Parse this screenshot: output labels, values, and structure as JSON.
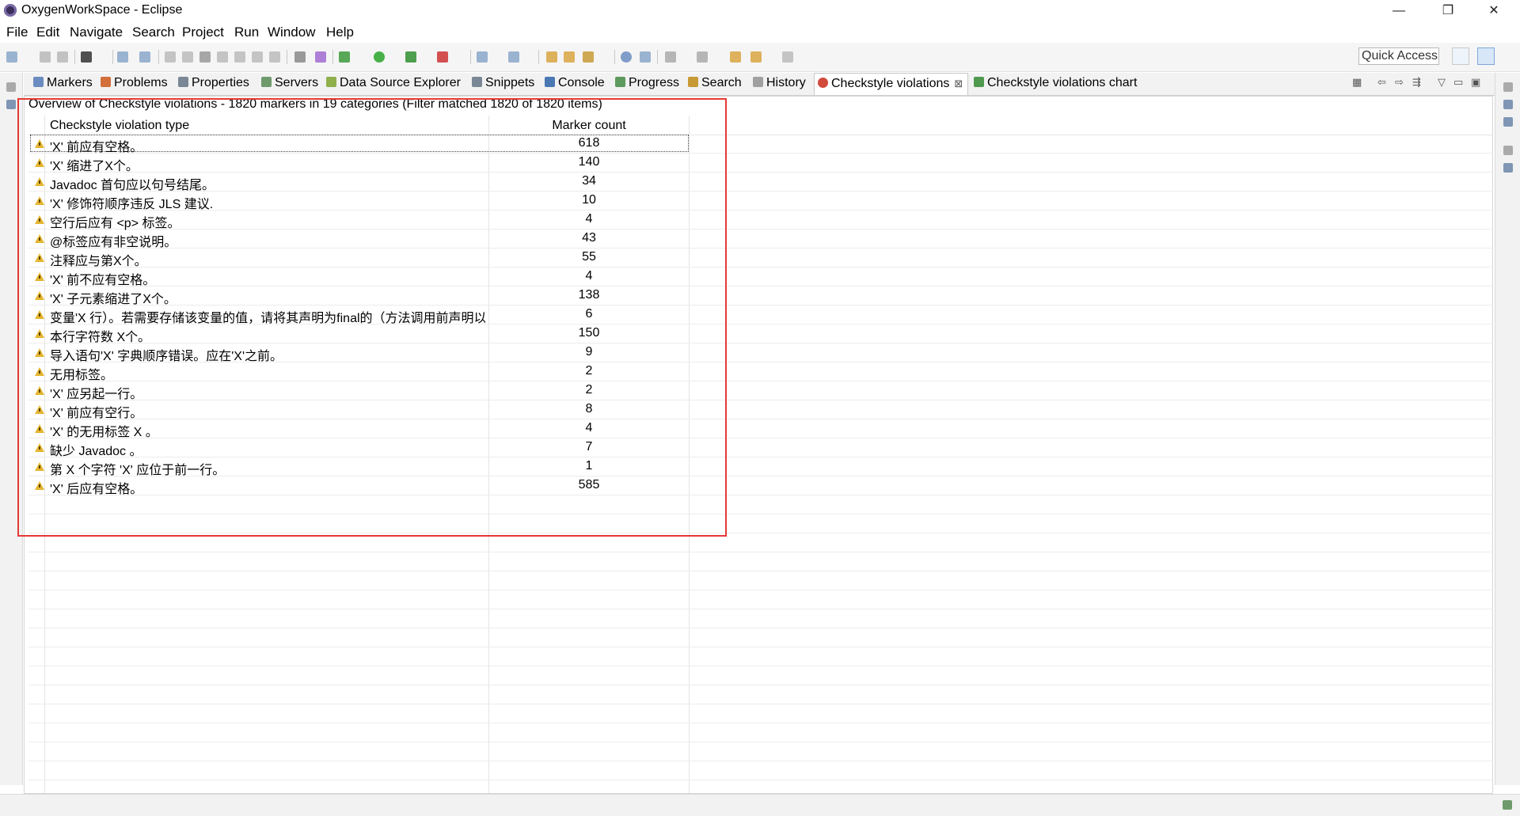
{
  "window": {
    "title": "OxygenWorkSpace - Eclipse",
    "minimize": "—",
    "restore": "❐",
    "close": "✕"
  },
  "menu": [
    "File",
    "Edit",
    "Navigate",
    "Search",
    "Project",
    "Run",
    "Window",
    "Help"
  ],
  "toolbar": {
    "quick_access": "Quick Access"
  },
  "tabs": [
    {
      "label": "Markers",
      "icon": "markers-icon",
      "color": "#6b8cc1"
    },
    {
      "label": "Problems",
      "icon": "problems-icon",
      "color": "#d36f3b"
    },
    {
      "label": "Properties",
      "icon": "properties-icon",
      "color": "#7a8794"
    },
    {
      "label": "Servers",
      "icon": "servers-icon",
      "color": "#6f9b6c"
    },
    {
      "label": "Data Source Explorer",
      "icon": "data-source-icon",
      "color": "#8fb04a"
    },
    {
      "label": "Snippets",
      "icon": "snippets-icon",
      "color": "#7a8794"
    },
    {
      "label": "Console",
      "icon": "console-icon",
      "color": "#4a78b3"
    },
    {
      "label": "Progress",
      "icon": "progress-icon",
      "color": "#5d9a5d"
    },
    {
      "label": "Search",
      "icon": "search-icon",
      "color": "#c89a36"
    },
    {
      "label": "History",
      "icon": "history-icon",
      "color": "#a0a0a0"
    },
    {
      "label": "Checkstyle violations",
      "icon": "checkstyle-icon",
      "color": "#d24a3c",
      "active": true
    },
    {
      "label": "Checkstyle violations chart",
      "icon": "checkstyle-chart-icon",
      "color": "#4f9a4f"
    }
  ],
  "view": {
    "summary": "Overview of Checkstyle violations - 1820 markers in 19 categories (Filter matched 1820 of 1820 items)",
    "columns": {
      "type": "Checkstyle violation type",
      "count": "Marker count"
    },
    "rows": [
      {
        "type": "'X' 前应有空格。",
        "count": "618"
      },
      {
        "type": "'X' 缩进了X个。",
        "count": "140"
      },
      {
        "type": "Javadoc 首句应以句号结尾。",
        "count": "34"
      },
      {
        "type": "'X' 修饰符顺序违反 JLS 建议.",
        "count": "10"
      },
      {
        "type": "空行后应有 <p> 标签。",
        "count": "4"
      },
      {
        "type": "@标签应有非空说明。",
        "count": "43"
      },
      {
        "type": "注释应与第X个。",
        "count": "55"
      },
      {
        "type": "'X' 前不应有空格。",
        "count": "4"
      },
      {
        "type": "'X' 子元素缩进了X个。",
        "count": "138"
      },
      {
        "type": "变量'X 行）。若需要存储该变量的值，请将其声明为final的（方法调用前声明以...",
        "count": "6"
      },
      {
        "type": "本行字符数 X个。",
        "count": "150"
      },
      {
        "type": "导入语句'X' 字典顺序错误。应在'X'之前。",
        "count": "9"
      },
      {
        "type": "无用标签。",
        "count": "2"
      },
      {
        "type": "'X' 应另起一行。",
        "count": "2"
      },
      {
        "type": "'X' 前应有空行。",
        "count": "8"
      },
      {
        "type": "'X' 的无用标签 X 。",
        "count": "4"
      },
      {
        "type": "缺少 Javadoc 。",
        "count": "7"
      },
      {
        "type": "第 X 个字符 'X' 应位于前一行。",
        "count": "1"
      },
      {
        "type": "'X' 后应有空格。",
        "count": "585"
      }
    ]
  }
}
